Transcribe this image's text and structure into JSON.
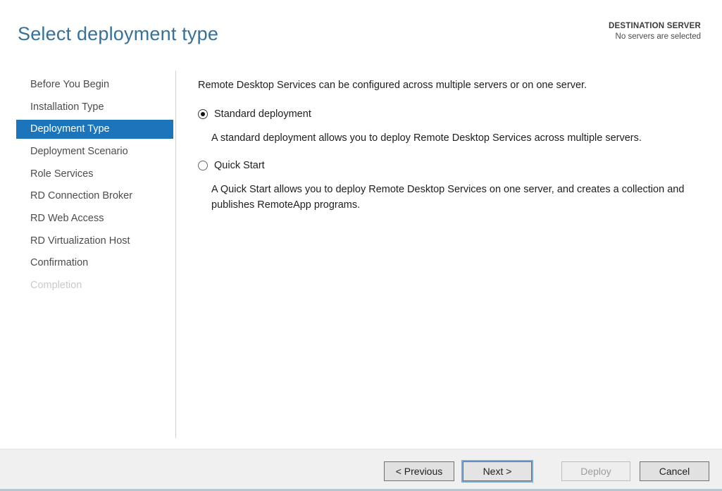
{
  "header": {
    "title": "Select deployment type",
    "destination": {
      "label": "DESTINATION SERVER",
      "value": "No servers are selected"
    }
  },
  "sidebar": {
    "items": [
      {
        "label": "Before You Begin",
        "state": "enabled"
      },
      {
        "label": "Installation Type",
        "state": "enabled"
      },
      {
        "label": "Deployment Type",
        "state": "selected"
      },
      {
        "label": "Deployment Scenario",
        "state": "enabled"
      },
      {
        "label": "Role Services",
        "state": "enabled"
      },
      {
        "label": "RD Connection Broker",
        "state": "enabled"
      },
      {
        "label": "RD Web Access",
        "state": "enabled"
      },
      {
        "label": "RD Virtualization Host",
        "state": "enabled"
      },
      {
        "label": "Confirmation",
        "state": "enabled"
      },
      {
        "label": "Completion",
        "state": "disabled"
      }
    ]
  },
  "main": {
    "intro": "Remote Desktop Services can be configured across multiple servers or on one server.",
    "options": [
      {
        "label": "Standard deployment",
        "description": "A standard deployment allows you to deploy Remote Desktop Services across multiple servers.",
        "selected": true
      },
      {
        "label": "Quick Start",
        "description": "A Quick Start allows you to deploy Remote Desktop Services on one server, and creates a collection and publishes RemoteApp programs.",
        "selected": false
      }
    ]
  },
  "footer": {
    "buttons": [
      {
        "label": "< Previous",
        "enabled": true
      },
      {
        "label": "Next >",
        "enabled": true,
        "focused": true
      },
      {
        "label": "Deploy",
        "enabled": false
      },
      {
        "label": "Cancel",
        "enabled": true
      }
    ]
  },
  "colors": {
    "accent_selected_nav": "#1c75bb",
    "title_text": "#35719b",
    "footer_background": "#f0f0f0",
    "bottom_strip": "#b7c7d1"
  }
}
